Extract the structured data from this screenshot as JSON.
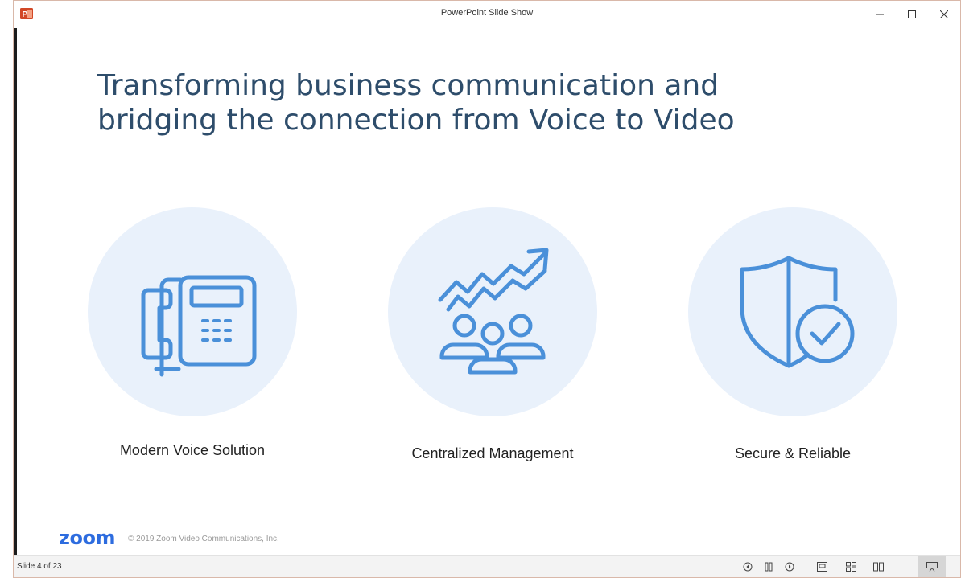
{
  "window": {
    "title": "PowerPoint Slide Show"
  },
  "slide": {
    "title_line1": "Transforming business communication and",
    "title_line2": "bridging the connection from Voice to Video",
    "features": [
      {
        "label": "Modern Voice Solution",
        "icon": "desk-phone-icon"
      },
      {
        "label": "Centralized Management",
        "icon": "growth-team-icon"
      },
      {
        "label": "Secure & Reliable",
        "icon": "shield-check-icon"
      }
    ],
    "logo_text": "zoom",
    "copyright": "© 2019 Zoom Video Communications, Inc."
  },
  "statusbar": {
    "slide_counter": "Slide 4 of 23"
  },
  "colors": {
    "accent": "#2d6cdf",
    "icon_blue": "#4a90d9",
    "circle_bg": "#e9f1fb",
    "title_color": "#2e4d6b"
  }
}
